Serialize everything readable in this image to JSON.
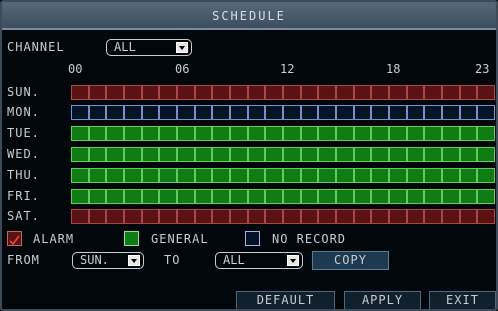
{
  "title": "SCHEDULE",
  "channel": {
    "label": "CHANNEL",
    "value": "ALL"
  },
  "hours": [
    "00",
    "06",
    "12",
    "18",
    "23"
  ],
  "days": [
    {
      "label": "SUN.",
      "mode": "alarm"
    },
    {
      "label": "MON.",
      "mode": "norec"
    },
    {
      "label": "TUE.",
      "mode": "general"
    },
    {
      "label": "WED.",
      "mode": "general"
    },
    {
      "label": "THU.",
      "mode": "general"
    },
    {
      "label": "FRI.",
      "mode": "general"
    },
    {
      "label": "SAT.",
      "mode": "alarm"
    }
  ],
  "legend": {
    "alarm": "ALARM",
    "general": "GENERAL",
    "no_record": "NO RECORD"
  },
  "copy_row": {
    "from_label": "FROM",
    "from_value": "SUN.",
    "to_label": "TO",
    "to_value": "ALL",
    "copy_button": "COPY"
  },
  "buttons": {
    "default": "DEFAULT",
    "apply": "APPLY",
    "exit": "EXIT"
  },
  "colors": {
    "alarm": "#5a1212",
    "general": "#0f7d14",
    "no_record": "#041426"
  }
}
